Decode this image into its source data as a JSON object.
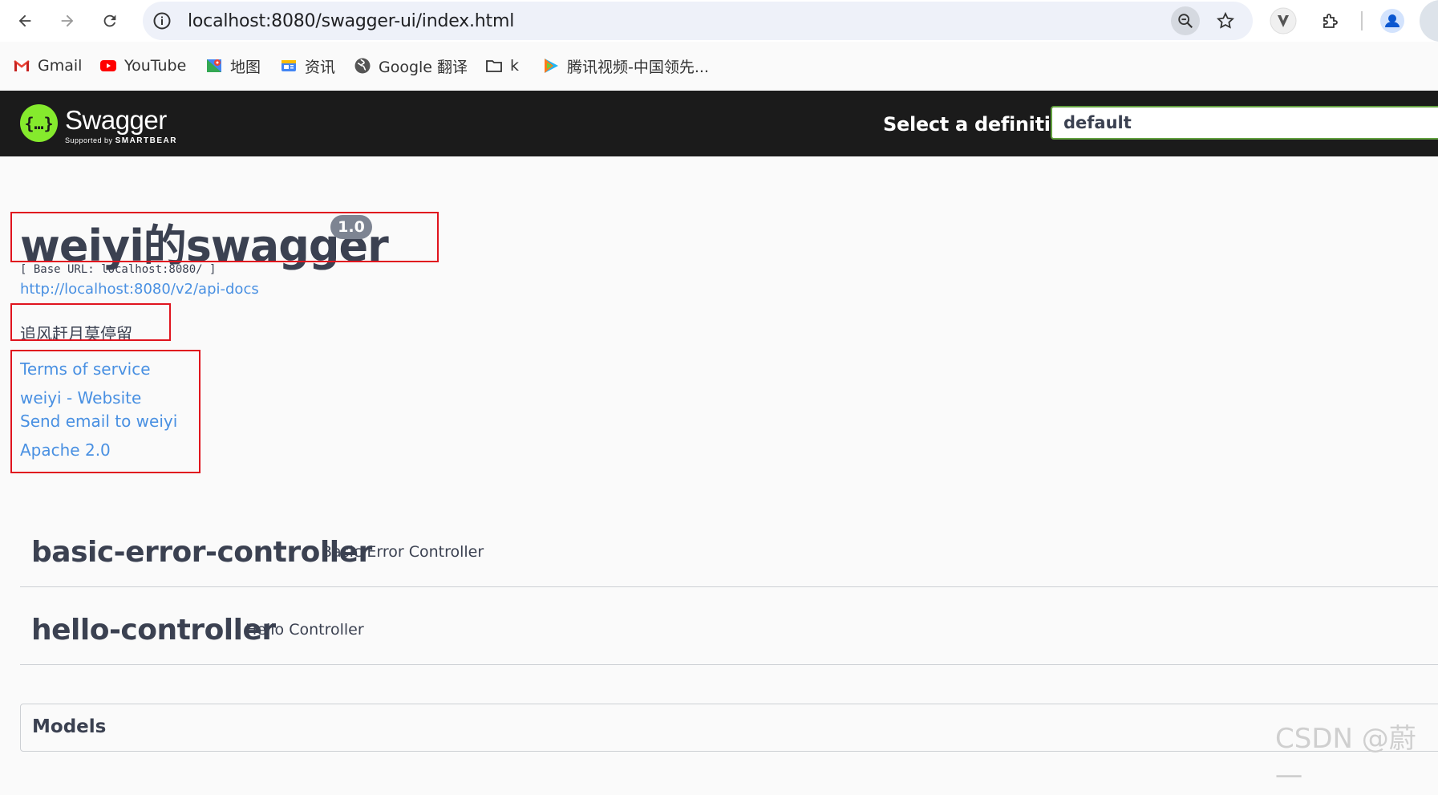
{
  "browser": {
    "url": "localhost:8080/swagger-ui/index.html",
    "bookmarks": [
      {
        "label": "Gmail",
        "icon": "gmail-icon"
      },
      {
        "label": "YouTube",
        "icon": "youtube-icon"
      },
      {
        "label": "地图",
        "icon": "maps-icon"
      },
      {
        "label": "资讯",
        "icon": "news-icon"
      },
      {
        "label": "Google 翻译",
        "icon": "globe-icon"
      },
      {
        "label": "k",
        "icon": "folder-icon"
      },
      {
        "label": "腾讯视频-中国领先...",
        "icon": "tencent-video-icon"
      }
    ]
  },
  "topbar": {
    "logo_text": "Swagger",
    "logo_sub_prefix": "Supported by",
    "logo_sub_brand": "SMARTBEAR",
    "select_label": "Select a definition",
    "select_value": "default"
  },
  "info": {
    "title": "weiyi的swagger",
    "version": "1.0",
    "base_url": "[ Base URL: localhost:8080/ ]",
    "api_docs": "http://localhost:8080/v2/api-docs",
    "description": "追风赶月莫停留",
    "links": {
      "terms": "Terms of service",
      "website": "weiyi - Website",
      "email": "Send email to weiyi",
      "license": "Apache 2.0"
    }
  },
  "tags": [
    {
      "name": "basic-error-controller",
      "description": "Basic Error Controller"
    },
    {
      "name": "hello-controller",
      "description": "Hello Controller"
    }
  ],
  "models_label": "Models",
  "watermark": "CSDN @蔚一",
  "colors": {
    "topbar_bg": "#1b1b1b",
    "accent_green": "#85ea2d",
    "link_blue": "#4990e2",
    "annotation_red": "#e0141e",
    "text_dark": "#3b4151"
  }
}
